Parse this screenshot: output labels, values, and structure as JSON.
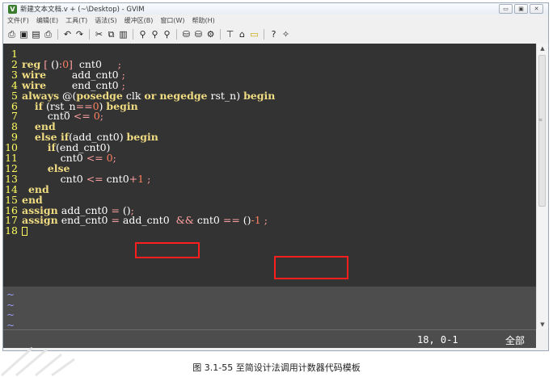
{
  "window": {
    "title": "新建文本文档.v + (~\\Desktop) - GVIM",
    "controls": [
      "▭",
      "▣",
      "✕"
    ]
  },
  "menu": [
    "文件(F)",
    "编辑(E)",
    "工具(T)",
    "语法(S)",
    "缓冲区(B)",
    "窗口(W)",
    "帮助(H)"
  ],
  "toolbar_icons": [
    "open-icon",
    "save-icon",
    "save-all-icon",
    "print-icon",
    "undo-icon",
    "redo-icon",
    "cut-icon",
    "copy-icon",
    "paste-icon",
    "find-icon",
    "find-next-icon",
    "find-prev-icon",
    "load-session-icon",
    "save-session-icon",
    "run-script-icon",
    "make-icon",
    "shell-icon",
    "ctags-icon",
    "help-icon",
    "help-search-icon"
  ],
  "toolbar_glyphs": [
    "⎙",
    "▣",
    "▤",
    "⎙",
    "↶",
    "↷",
    "✂",
    "⧉",
    "▥",
    "⚲",
    "⚲",
    "⚲",
    "⛁",
    "⛁",
    "⚙",
    "⊤",
    "⌂",
    "▭",
    "?",
    "✧"
  ],
  "lines": [
    [
      {
        "t": "",
        "c": "plain"
      }
    ],
    [
      {
        "t": "reg",
        "c": "kw"
      },
      {
        "t": " [ ",
        "c": "op"
      },
      {
        "t": "()",
        "c": "plain"
      },
      {
        "t": ":",
        "c": "op"
      },
      {
        "t": "0",
        "c": "num"
      },
      {
        "t": "]",
        "c": "op"
      },
      {
        "t": "  cnt0     ",
        "c": "plain"
      },
      {
        "t": ";",
        "c": "op"
      }
    ],
    [
      {
        "t": "wire",
        "c": "kw"
      },
      {
        "t": "        add_cnt0 ",
        "c": "plain"
      },
      {
        "t": ";",
        "c": "op"
      }
    ],
    [
      {
        "t": "wire",
        "c": "kw"
      },
      {
        "t": "        end_cnt0 ",
        "c": "plain"
      },
      {
        "t": ";",
        "c": "op"
      }
    ],
    [
      {
        "t": "always",
        "c": "kw"
      },
      {
        "t": " @(",
        "c": "plain"
      },
      {
        "t": "posedge",
        "c": "kw"
      },
      {
        "t": " clk ",
        "c": "plain"
      },
      {
        "t": "or",
        "c": "kw"
      },
      {
        "t": " ",
        "c": "plain"
      },
      {
        "t": "negedge",
        "c": "kw"
      },
      {
        "t": " rst_n) ",
        "c": "plain"
      },
      {
        "t": "begin",
        "c": "kw"
      }
    ],
    [
      {
        "t": "    ",
        "c": "plain"
      },
      {
        "t": "if",
        "c": "kw"
      },
      {
        "t": " (rst_n",
        "c": "plain"
      },
      {
        "t": "==",
        "c": "op"
      },
      {
        "t": "0",
        "c": "num"
      },
      {
        "t": ") ",
        "c": "plain"
      },
      {
        "t": "begin",
        "c": "kw"
      }
    ],
    [
      {
        "t": "        cnt0 ",
        "c": "plain"
      },
      {
        "t": "<=",
        "c": "op"
      },
      {
        "t": " ",
        "c": "plain"
      },
      {
        "t": "0",
        "c": "num"
      },
      {
        "t": ";",
        "c": "op"
      }
    ],
    [
      {
        "t": "    ",
        "c": "plain"
      },
      {
        "t": "end",
        "c": "kw"
      }
    ],
    [
      {
        "t": "    ",
        "c": "plain"
      },
      {
        "t": "else if",
        "c": "kw"
      },
      {
        "t": "(add_cnt0) ",
        "c": "plain"
      },
      {
        "t": "begin",
        "c": "kw"
      }
    ],
    [
      {
        "t": "        ",
        "c": "plain"
      },
      {
        "t": "if",
        "c": "kw"
      },
      {
        "t": "(end_cnt0)",
        "c": "plain"
      }
    ],
    [
      {
        "t": "            cnt0 ",
        "c": "plain"
      },
      {
        "t": "<=",
        "c": "op"
      },
      {
        "t": " ",
        "c": "plain"
      },
      {
        "t": "0",
        "c": "num"
      },
      {
        "t": ";",
        "c": "op"
      }
    ],
    [
      {
        "t": "        ",
        "c": "plain"
      },
      {
        "t": "else",
        "c": "kw"
      }
    ],
    [
      {
        "t": "            cnt0 ",
        "c": "plain"
      },
      {
        "t": "<=",
        "c": "op"
      },
      {
        "t": " cnt0",
        "c": "plain"
      },
      {
        "t": "+",
        "c": "op"
      },
      {
        "t": "1",
        "c": "num"
      },
      {
        "t": " ;",
        "c": "op"
      }
    ],
    [
      {
        "t": "  ",
        "c": "plain"
      },
      {
        "t": "end",
        "c": "kw"
      }
    ],
    [
      {
        "t": "end",
        "c": "kw"
      }
    ],
    [
      {
        "t": "assign",
        "c": "kw"
      },
      {
        "t": " add_cnt0 ",
        "c": "plain"
      },
      {
        "t": "=",
        "c": "op"
      },
      {
        "t": " ()",
        "c": "plain"
      },
      {
        "t": ";",
        "c": "op"
      }
    ],
    [
      {
        "t": "assign",
        "c": "kw"
      },
      {
        "t": " end_cnt0 ",
        "c": "plain"
      },
      {
        "t": "=",
        "c": "op"
      },
      {
        "t": " add_cnt0  ",
        "c": "plain"
      },
      {
        "t": "&&",
        "c": "op"
      },
      {
        "t": " cnt0 ",
        "c": "plain"
      },
      {
        "t": "==",
        "c": "op"
      },
      {
        "t": " ()",
        "c": "plain"
      },
      {
        "t": "-1",
        "c": "num"
      },
      {
        "t": " ;",
        "c": "op"
      }
    ],
    [
      {
        "t": "",
        "c": "cursor"
      }
    ]
  ],
  "tildes": [
    "~",
    "~",
    "~",
    "~"
  ],
  "status": {
    "position": "18, 0-1",
    "percent": "全部"
  },
  "caption": "图 3.1-55 至简设计法调用计数器代码模板",
  "colors": {
    "editor_bg": "#333333",
    "keyword": "#f0dc82",
    "line_number": "#ffff60",
    "highlight_box": "#ff1e1e"
  }
}
